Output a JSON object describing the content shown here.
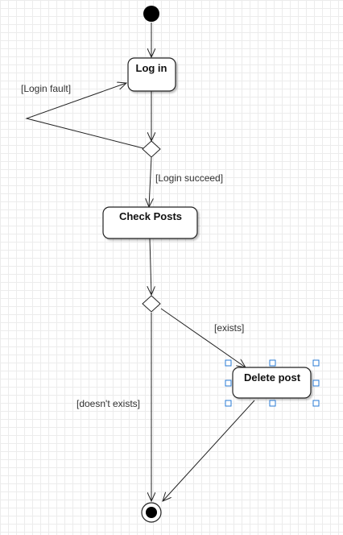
{
  "nodes": {
    "login": "Log in",
    "check_posts": "Check Posts",
    "delete_post": "Delete post"
  },
  "edges": {
    "login_fault": "[Login fault]",
    "login_succeed": "[Login succeed]",
    "exists": "[exists]",
    "doesnt_exists": "[doesn't exists]"
  },
  "colors": {
    "stroke": "#222222",
    "selection": "#2a7bd6",
    "grid": "#ececec"
  }
}
